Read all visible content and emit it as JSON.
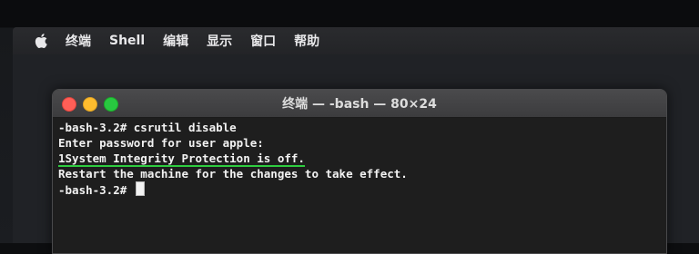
{
  "menubar": {
    "apple_icon": "apple-logo-icon",
    "items": [
      {
        "label": "终端"
      },
      {
        "label": "Shell"
      },
      {
        "label": "编辑"
      },
      {
        "label": "显示"
      },
      {
        "label": "窗口"
      },
      {
        "label": "帮助"
      }
    ]
  },
  "window": {
    "title": "终端 — -bash — 80×24",
    "traffic_lights": {
      "close": "#ff5f57",
      "minimize": "#febc2e",
      "maximize": "#28c840"
    }
  },
  "terminal": {
    "lines": [
      "-bash-3.2# csrutil disable",
      "Enter password for user apple:",
      "1System Integrity Protection is off.",
      "Restart the machine for the changes to take effect.",
      "-bash-3.2# "
    ],
    "highlight_color": "#2ecc40"
  }
}
